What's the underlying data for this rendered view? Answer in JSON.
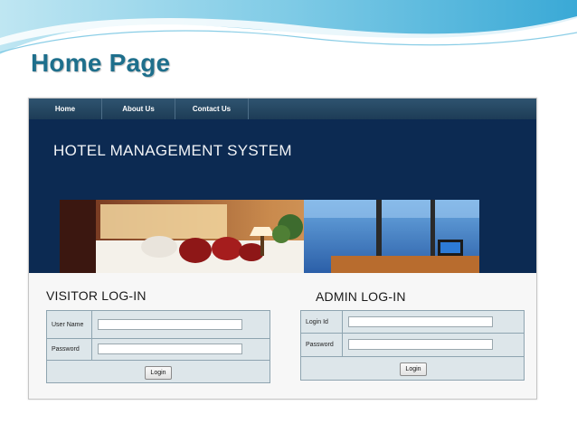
{
  "slide": {
    "title": "Home Page"
  },
  "nav": {
    "items": [
      {
        "label": "Home"
      },
      {
        "label": "About Us"
      },
      {
        "label": "Contact Us"
      }
    ]
  },
  "header": {
    "app_title": "HOTEL MANAGEMENT SYSTEM"
  },
  "visitor_login": {
    "heading": "VISITOR LOG-IN",
    "username_label": "User Name",
    "password_label": "Password",
    "username_value": "",
    "password_value": "",
    "login_button": "Login"
  },
  "admin_login": {
    "heading": "ADMIN LOG-IN",
    "loginid_label": "Login Id",
    "password_label": "Password",
    "loginid_value": "",
    "password_value": "",
    "login_button": "Login"
  },
  "colors": {
    "nav_bg": "#1d3c56",
    "header_bg": "#0c2a52",
    "title_color": "#1e6f8c",
    "form_bg": "#dde6ea"
  }
}
